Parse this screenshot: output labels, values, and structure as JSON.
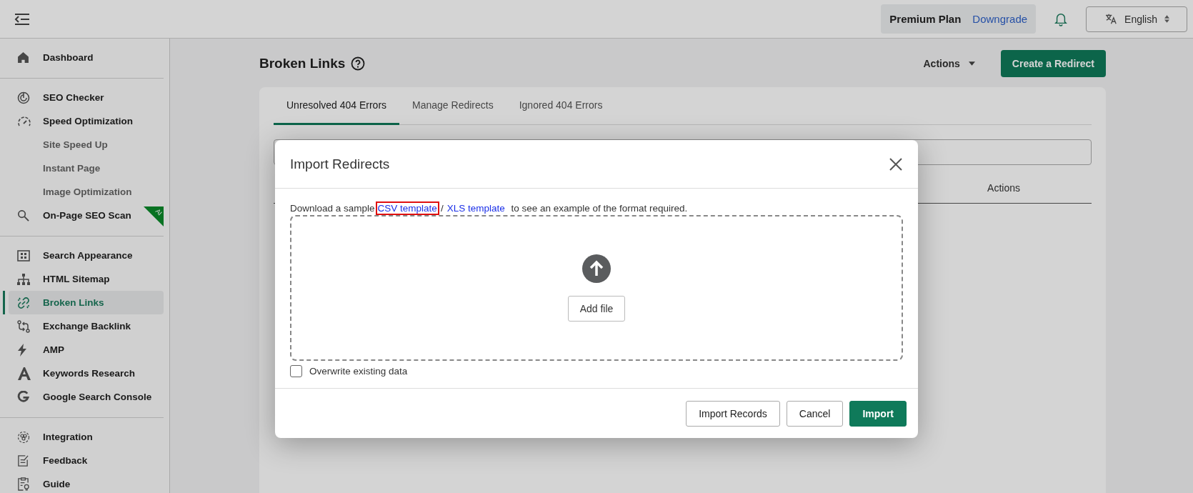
{
  "topbar": {
    "plan": "Premium Plan",
    "plan_link": "Downgrade",
    "language": "English"
  },
  "sidebar": {
    "groups": [
      {
        "items": [
          {
            "label": "Dashboard",
            "selected": false
          }
        ]
      },
      {
        "items": [
          {
            "label": "SEO Checker",
            "selected": false
          },
          {
            "label": "Speed Optimization",
            "selected": false,
            "children": [
              {
                "label": "Site Speed Up",
                "selected": false
              },
              {
                "label": "Instant Page",
                "selected": false
              },
              {
                "label": "Image Optimization",
                "selected": false
              }
            ]
          },
          {
            "label": "On-Page SEO Scan",
            "selected": false,
            "badge": "AI"
          }
        ]
      },
      {
        "items": [
          {
            "label": "Search Appearance",
            "selected": false
          },
          {
            "label": "HTML Sitemap",
            "selected": false
          },
          {
            "label": "Broken Links",
            "selected": true
          },
          {
            "label": "Exchange Backlink",
            "selected": false
          },
          {
            "label": "AMP",
            "selected": false
          },
          {
            "label": "Keywords Research",
            "selected": false
          },
          {
            "label": "Google Search Console",
            "selected": false
          }
        ]
      },
      {
        "items": [
          {
            "label": "Integration",
            "selected": false
          },
          {
            "label": "Feedback",
            "selected": false
          },
          {
            "label": "Guide",
            "selected": false
          }
        ]
      }
    ]
  },
  "page": {
    "title": "Broken Links",
    "actions": "Actions",
    "primary_button": "Create a Redirect",
    "tabs": [
      {
        "label": "Unresolved 404 Errors",
        "selected": true
      },
      {
        "label": "Manage Redirects",
        "selected": false
      },
      {
        "label": "Ignored 404 Errors",
        "selected": false
      }
    ],
    "table": {
      "columns": [
        "Actions"
      ]
    }
  },
  "modal": {
    "title": "Import Redirects",
    "intro": {
      "before": "Download a sample",
      "links": [
        {
          "label": "CSV template",
          "highlighted": true
        },
        {
          "label": "XLS template",
          "highlighted": false
        }
      ],
      "separator": "/",
      "after": "to see an example of the format required."
    },
    "add_file": "Add file",
    "overwrite": {
      "label": "Overwrite existing data",
      "checked": false
    },
    "buttons": [
      {
        "label": "Import Records",
        "kind": "secondary"
      },
      {
        "label": "Cancel",
        "kind": "secondary"
      },
      {
        "label": "Import",
        "kind": "primary"
      }
    ]
  }
}
